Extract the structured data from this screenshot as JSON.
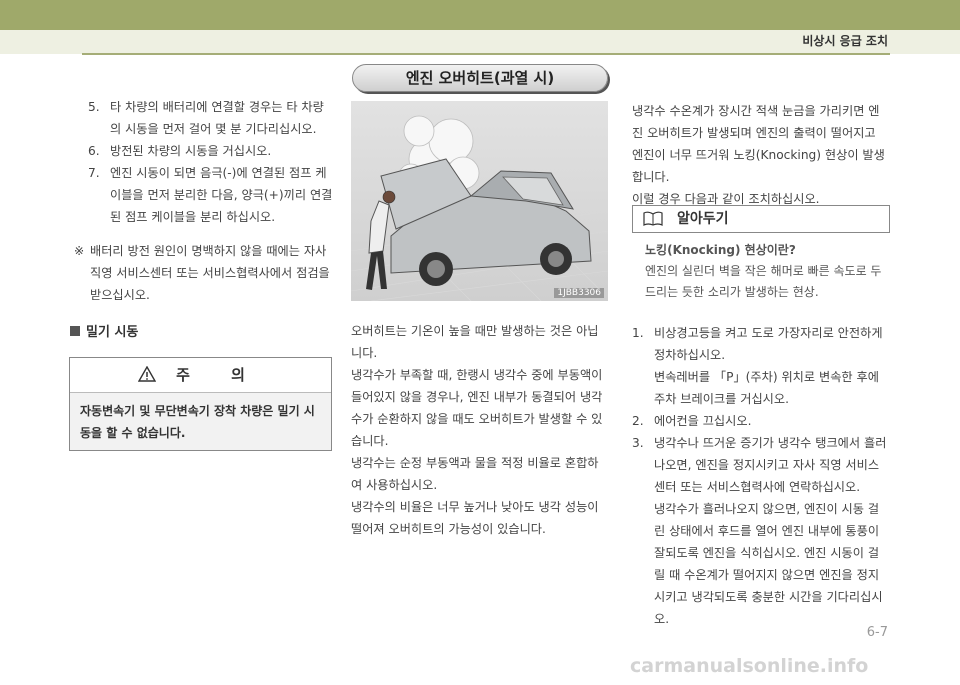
{
  "header": {
    "section_title": "비상시 응급 조치"
  },
  "title": "엔진 오버히트(과열 시)",
  "left": {
    "steps": [
      {
        "num": "5.",
        "text": "타 차량의 배터리에 연결할 경우는 타 차량의 시동을 먼저 걸어 몇 분 기다리십시오."
      },
      {
        "num": "6.",
        "text": "방전된 차량의 시동을 거십시오."
      },
      {
        "num": "7.",
        "text": "엔진 시동이 되면 음극(-)에 연결된 점프 케이블을 먼저 분리한 다음, 양극(+)끼리 연결된 점프 케이블을 분리 하십시오."
      }
    ],
    "note_mark": "※",
    "note_text": "배터리 방전 원인이 명백하지 않을 때에는 자사 직영 서비스센터 또는 서비스협력사에서 점검을 받으십시오.",
    "subheading": "밀기 시동",
    "caution": {
      "label": "주 의",
      "body": "자동변속기 및 무단변속기 장착 차량은 밀기 시동을 할 수 없습니다."
    }
  },
  "figure": {
    "code": "1JBB3306"
  },
  "middle": {
    "paragraphs": [
      "오버히트는 기온이 높을 때만 발생하는 것은 아닙니다.",
      "냉각수가 부족할 때, 한랭시 냉각수 중에 부동액이 들어있지 않을 경우나, 엔진 내부가 동결되어 냉각수가 순환하지 않을 때도 오버히트가 발생할 수 있습니다.",
      "냉각수는 순정 부동액과 물을 적정 비율로 혼합하여 사용하십시오.",
      "냉각수의 비율은 너무 높거나 낮아도 냉각 성능이 떨어져 오버히트의 가능성이 있습니다."
    ]
  },
  "right": {
    "intro": "냉각수 수온계가 장시간 적색 눈금을 가리키면 엔진 오버히트가 발생되며 엔진의 출력이 떨어지고 엔진이 너무 뜨거워 노킹(Knocking) 현상이 발생합니다.",
    "intro2": "이럴 경우 다음과 같이 조치하십시오.",
    "tip_label": "알아두기",
    "tip_title": "노킹(Knocking) 현상이란?",
    "tip_text": "엔진의 실린더 벽을 작은 해머로 빠른 속도로 두드리는 듯한 소리가 발생하는 현상.",
    "steps": [
      {
        "num": "1.",
        "text": "비상경고등을 켜고 도로 가장자리로 안전하게 정차하십시오.",
        "sub": "변속레버를 「P」(주차) 위치로 변속한 후에 주차 브레이크를 거십시오."
      },
      {
        "num": "2.",
        "text": "에어컨을 끄십시오.",
        "sub": ""
      },
      {
        "num": "3.",
        "text": "냉각수나 뜨거운 증기가 냉각수 탱크에서 흘러나오면, 엔진을 정지시키고 자사 직영 서비스센터 또는 서비스협력사에 연락하십시오.",
        "sub": "냉각수가 흘러나오지 않으면, 엔진이 시동 걸린 상태에서 후드를 열어 엔진 내부에 통풍이 잘되도록 엔진을 식히십시오. 엔진 시동이 걸릴 때 수온계가 떨어지지 않으면 엔진을 정지시키고 냉각되도록 충분한 시간을 기다리십시오."
      }
    ]
  },
  "footer": {
    "page": "6-7",
    "watermark": "carmanualsonline.info"
  }
}
